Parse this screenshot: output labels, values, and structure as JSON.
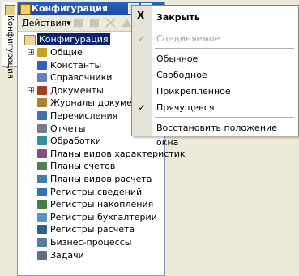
{
  "side_tab": {
    "label": "Конфигурация"
  },
  "window": {
    "title": "Конфигурация",
    "pin_glyph": "▾",
    "close_glyph": "x"
  },
  "toolbar": {
    "actions_label": "Действия",
    "actions_arrow": "▾"
  },
  "tree": {
    "root": "Конфигурация",
    "items": [
      "Общие",
      "Константы",
      "Справочники",
      "Документы",
      "Журналы документов",
      "Перечисления",
      "Отчеты",
      "Обработки",
      "Планы видов характеристик",
      "Планы счетов",
      "Планы видов расчета",
      "Регистры сведений",
      "Регистры накопления",
      "Регистры бухгалтерии",
      "Регистры расчета",
      "Бизнес-процессы",
      "Задачи"
    ]
  },
  "menu": {
    "close_x_glyph": "X",
    "items": [
      {
        "label": "Закрыть",
        "check": ""
      },
      {
        "label": "Соединяемое",
        "check": "✓"
      },
      {
        "label": "Обычное",
        "check": ""
      },
      {
        "label": "Свободное",
        "check": ""
      },
      {
        "label": "Прикрепленное",
        "check": ""
      },
      {
        "label": "Прячущееся",
        "check": "✓"
      },
      {
        "label": "Восстановить положение окна",
        "check": ""
      }
    ]
  }
}
